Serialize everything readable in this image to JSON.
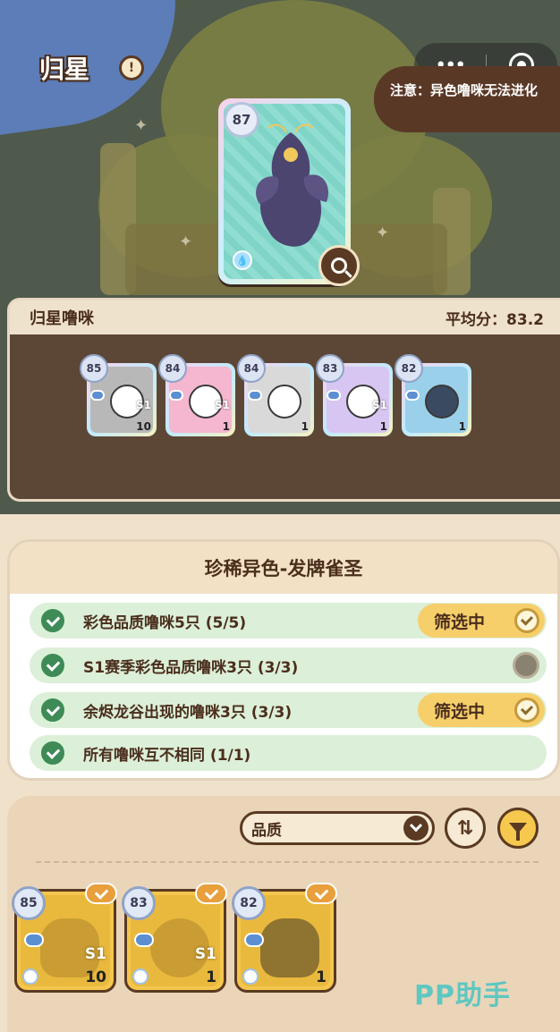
{
  "header": {
    "title": "归星",
    "notice": "注意：异色噜咪无法进化"
  },
  "capsule": {
    "more_icon": "more-dots-icon",
    "close_icon": "target-circle-icon"
  },
  "main_pet": {
    "level": "87",
    "element_icon": "water-drop-icon"
  },
  "team": {
    "title": "归星噜咪",
    "score_label": "平均分：83.2",
    "members": [
      {
        "level": "85",
        "season": "S1",
        "count": "10",
        "frame": "#b8b8b8"
      },
      {
        "level": "84",
        "season": "S1",
        "count": "1",
        "frame": "#f5b6cf"
      },
      {
        "level": "84",
        "season": "",
        "count": "1",
        "frame": "#d9d9d9"
      },
      {
        "level": "83",
        "season": "S1",
        "count": "1",
        "frame": "#d8c6f2"
      },
      {
        "level": "82",
        "season": "",
        "count": "1",
        "frame": "#9ad0ea"
      }
    ]
  },
  "quest": {
    "title": "珍稀异色-发牌雀圣",
    "requirements": [
      {
        "text": "彩色品质噜咪5只 (5/5)",
        "filter_label": "筛选中",
        "filtering": true
      },
      {
        "text": "S1赛季彩色品质噜咪3只 (3/3)",
        "filter_label": "",
        "filtering": false
      },
      {
        "text": "余烬龙谷出现的噜咪3只 (3/3)",
        "filter_label": "筛选中",
        "filtering": true
      },
      {
        "text": "所有噜咪互不相同 (1/1)",
        "filter_label": "",
        "filtering": false
      }
    ]
  },
  "picker": {
    "sort_label": "品质",
    "cards": [
      {
        "level": "85",
        "season": "S1",
        "count": "10"
      },
      {
        "level": "83",
        "season": "S1",
        "count": "1"
      },
      {
        "level": "82",
        "season": "",
        "count": "1"
      }
    ]
  },
  "watermark": "PP助手",
  "colors": {
    "accent_yellow": "#f6cf6b",
    "brown": "#5a3a22",
    "green_row": "#dcefd8",
    "check_green": "#3f8b57"
  }
}
